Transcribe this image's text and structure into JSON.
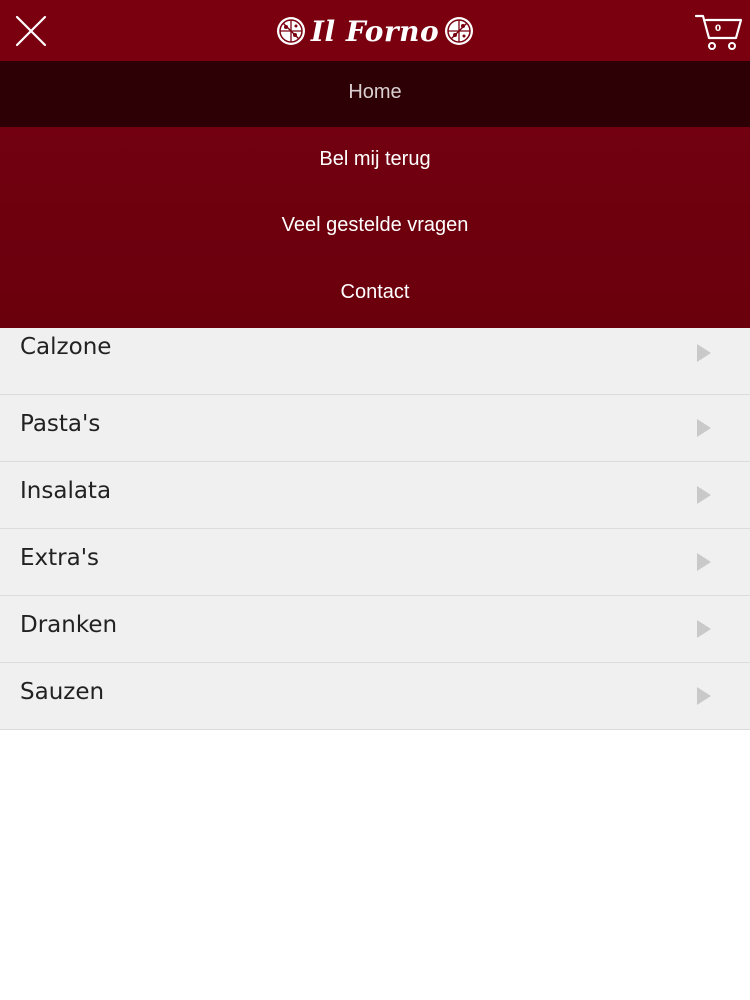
{
  "header": {
    "logo_text": "Il Forno",
    "close_icon": "close-icon",
    "cart_icon": "cart-icon",
    "cart_count": "0",
    "color": "#7a0010"
  },
  "nav": {
    "items": [
      {
        "label": "Home",
        "active": true
      },
      {
        "label": "Bel mij terug",
        "active": false
      },
      {
        "label": "Veel gestelde vragen",
        "active": false
      },
      {
        "label": "Contact",
        "active": false
      }
    ],
    "active_color": "#2c0005"
  },
  "menu": {
    "items": [
      {
        "label": "Calzone",
        "icon": "chevron-right-icon"
      },
      {
        "label": "Pasta's",
        "icon": "chevron-right-icon"
      },
      {
        "label": "Insalata",
        "icon": "chevron-right-icon"
      },
      {
        "label": "Extra's",
        "icon": "chevron-right-icon"
      },
      {
        "label": "Dranken",
        "icon": "chevron-right-icon"
      },
      {
        "label": "Sauzen",
        "icon": "chevron-right-icon"
      }
    ]
  }
}
